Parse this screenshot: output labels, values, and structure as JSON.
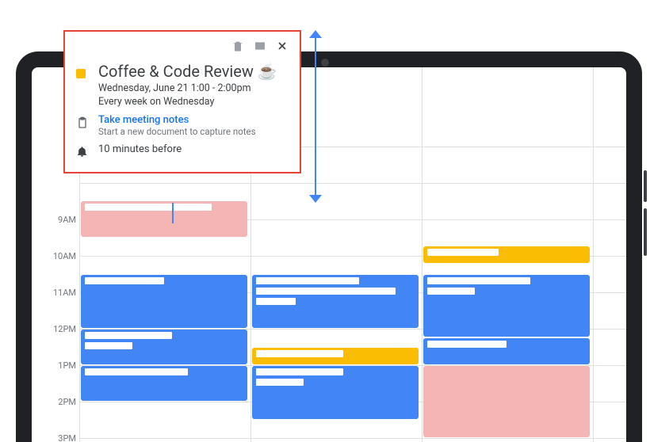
{
  "popup": {
    "title": "Coffee & Code Review ☕",
    "date_line": "Wednesday, June 21    1:00 - 2:00pm",
    "recurrence": "Every week on Wednesday",
    "notes_link": "Take meeting notes",
    "notes_sub": "Start a new document to capture notes",
    "reminder": "10 minutes before",
    "color": "#fbbc04"
  },
  "time_labels": [
    "9AM",
    "10AM",
    "11AM",
    "12PM",
    "1PM",
    "2PM",
    "3PM"
  ],
  "colors": {
    "blue": "#4285f4",
    "pink": "#f4b5b5",
    "orange": "#fbbc04",
    "popup_border": "#ea4335",
    "link": "#1a73e8"
  },
  "events": [
    {
      "col": 0,
      "start": "8:30",
      "end": "9:30",
      "color": "pink"
    },
    {
      "col": 0,
      "start": "10:30",
      "end": "12:00",
      "color": "blue"
    },
    {
      "col": 0,
      "start": "12:00",
      "end": "1:00",
      "color": "blue"
    },
    {
      "col": 0,
      "start": "1:00",
      "end": "2:00",
      "color": "blue"
    },
    {
      "col": 1,
      "start": "10:30",
      "end": "12:00",
      "color": "blue"
    },
    {
      "col": 1,
      "start": "12:30",
      "end": "1:00",
      "color": "orange"
    },
    {
      "col": 1,
      "start": "1:00",
      "end": "2:30",
      "color": "blue"
    },
    {
      "col": 2,
      "start": "9:45",
      "end": "10:15",
      "color": "orange"
    },
    {
      "col": 2,
      "start": "10:30",
      "end": "12:15",
      "color": "blue"
    },
    {
      "col": 2,
      "start": "12:15",
      "end": "1:00",
      "color": "blue"
    },
    {
      "col": 2,
      "start": "1:00",
      "end": "3:00",
      "color": "pink"
    }
  ]
}
